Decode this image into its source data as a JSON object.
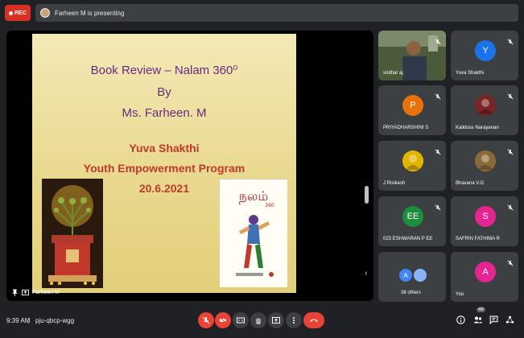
{
  "header": {
    "rec_label": "REC",
    "presenting_text": "Farheen M is presenting"
  },
  "slide": {
    "title_line1": "Book Review – Nalam 360⁰",
    "title_line2": "By",
    "title_line3": "Ms. Farheen. M",
    "sub_line1": "Yuva Shakthi",
    "sub_line2": "Youth Empowerment Program",
    "sub_line3": "20.6.2021",
    "book_title": "நலம்",
    "book_subtitle": "360",
    "presenter_label": "Farheen M"
  },
  "participants": [
    {
      "name": "sridhar aj",
      "initial": "",
      "avatar_color": "#556b2f",
      "type": "video"
    },
    {
      "name": "Yuva Shakthi",
      "initial": "Y",
      "avatar_color": "#1a73e8",
      "type": "letter"
    },
    {
      "name": "PRIYADHARSHINI S",
      "initial": "P",
      "avatar_color": "#e8710a",
      "type": "letter"
    },
    {
      "name": "Kalidoss Narayanan",
      "initial": "",
      "avatar_color": "#7a2424",
      "type": "image"
    },
    {
      "name": "J Risikesh",
      "initial": "",
      "avatar_color": "#e0b400",
      "type": "image"
    },
    {
      "name": "Bhavana V.G",
      "initial": "",
      "avatar_color": "#8a6a3a",
      "type": "image"
    },
    {
      "name": "023 ESHWARAN P EE",
      "initial": "EE",
      "avatar_color": "#1e8e3e",
      "type": "letter"
    },
    {
      "name": "SAFRIN FATHIMA R",
      "initial": "S",
      "avatar_color": "#e52592",
      "type": "letter"
    },
    {
      "name": "38 others",
      "initial": "A",
      "avatar_color": "#4285f4",
      "type": "others"
    },
    {
      "name": "You",
      "initial": "A",
      "avatar_color": "#e52592",
      "type": "letter"
    }
  ],
  "footer": {
    "time": "9:39 AM",
    "separator": "|",
    "meeting_code": "pju-qbcp-wgg",
    "people_count": "48"
  },
  "colors": {
    "background": "#202124",
    "tile": "#3c4043",
    "danger": "#ea4335",
    "slide_title": "#6a2a80",
    "slide_sub": "#c0392b"
  }
}
